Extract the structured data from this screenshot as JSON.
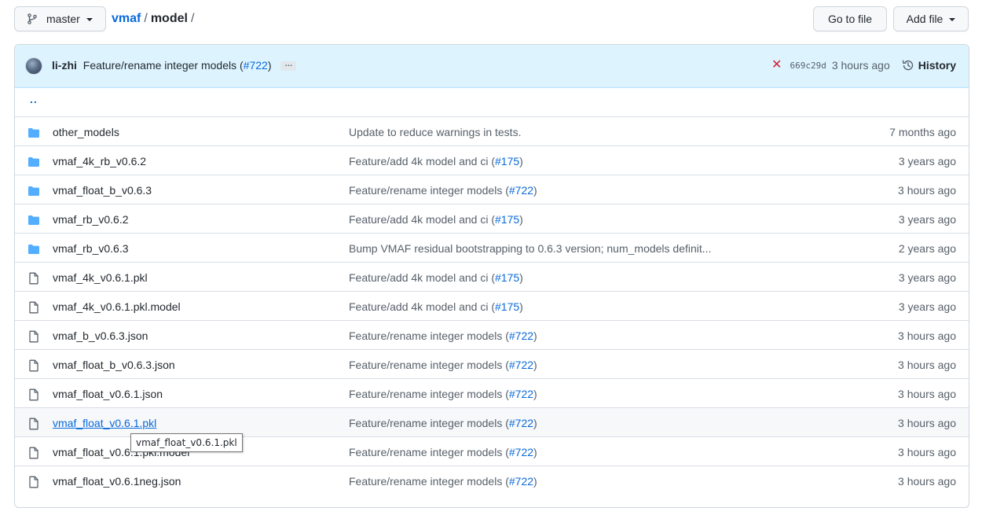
{
  "header": {
    "branch_label": "master",
    "breadcrumb_root": "vmaf",
    "breadcrumb_sep": "/",
    "breadcrumb_current": "model",
    "breadcrumb_trailing": "/",
    "go_to_file": "Go to file",
    "add_file": "Add file"
  },
  "commit": {
    "author": "li-zhi",
    "message_prefix": "Feature/rename integer models (",
    "pr": "#722",
    "message_suffix": ")",
    "ellipsis": "…",
    "status": "✕",
    "sha": "669c29d",
    "time": "3 hours ago",
    "history_label": "History"
  },
  "parent": "..",
  "files": [
    {
      "type": "dir",
      "name": "other_models",
      "msg": "Update to reduce warnings in tests.",
      "pr": "",
      "msg_suffix": "",
      "age": "7 months ago"
    },
    {
      "type": "dir",
      "name": "vmaf_4k_rb_v0.6.2",
      "msg": "Feature/add 4k model and ci (",
      "pr": "#175",
      "msg_suffix": ")",
      "age": "3 years ago"
    },
    {
      "type": "dir",
      "name": "vmaf_float_b_v0.6.3",
      "msg": "Feature/rename integer models (",
      "pr": "#722",
      "msg_suffix": ")",
      "age": "3 hours ago"
    },
    {
      "type": "dir",
      "name": "vmaf_rb_v0.6.2",
      "msg": "Feature/add 4k model and ci (",
      "pr": "#175",
      "msg_suffix": ")",
      "age": "3 years ago"
    },
    {
      "type": "dir",
      "name": "vmaf_rb_v0.6.3",
      "msg": "Bump VMAF residual bootstrapping to 0.6.3 version; num_models definit...",
      "pr": "",
      "msg_suffix": "",
      "age": "2 years ago"
    },
    {
      "type": "file",
      "name": "vmaf_4k_v0.6.1.pkl",
      "msg": "Feature/add 4k model and ci (",
      "pr": "#175",
      "msg_suffix": ")",
      "age": "3 years ago"
    },
    {
      "type": "file",
      "name": "vmaf_4k_v0.6.1.pkl.model",
      "msg": "Feature/add 4k model and ci (",
      "pr": "#175",
      "msg_suffix": ")",
      "age": "3 years ago"
    },
    {
      "type": "file",
      "name": "vmaf_b_v0.6.3.json",
      "msg": "Feature/rename integer models (",
      "pr": "#722",
      "msg_suffix": ")",
      "age": "3 hours ago"
    },
    {
      "type": "file",
      "name": "vmaf_float_b_v0.6.3.json",
      "msg": "Feature/rename integer models (",
      "pr": "#722",
      "msg_suffix": ")",
      "age": "3 hours ago"
    },
    {
      "type": "file",
      "name": "vmaf_float_v0.6.1.json",
      "msg": "Feature/rename integer models (",
      "pr": "#722",
      "msg_suffix": ")",
      "age": "3 hours ago"
    },
    {
      "type": "file",
      "name": "vmaf_float_v0.6.1.pkl",
      "msg": "Feature/rename integer models (",
      "pr": "#722",
      "msg_suffix": ")",
      "age": "3 hours ago",
      "hovered": true
    },
    {
      "type": "file",
      "name": "vmaf_float_v0.6.1.pkl.model",
      "msg": "Feature/rename integer models (",
      "pr": "#722",
      "msg_suffix": ")",
      "age": "3 hours ago"
    },
    {
      "type": "file",
      "name": "vmaf_float_v0.6.1neg.json",
      "msg": "Feature/rename integer models (",
      "pr": "#722",
      "msg_suffix": ")",
      "age": "3 hours ago"
    }
  ],
  "tooltip": "vmaf_float_v0.6.1.pkl",
  "colors": {
    "folder": "#54aeff",
    "file": "#57606a",
    "link": "#0969da",
    "commit_bg": "#ddf4ff",
    "fail": "#cf222e"
  }
}
